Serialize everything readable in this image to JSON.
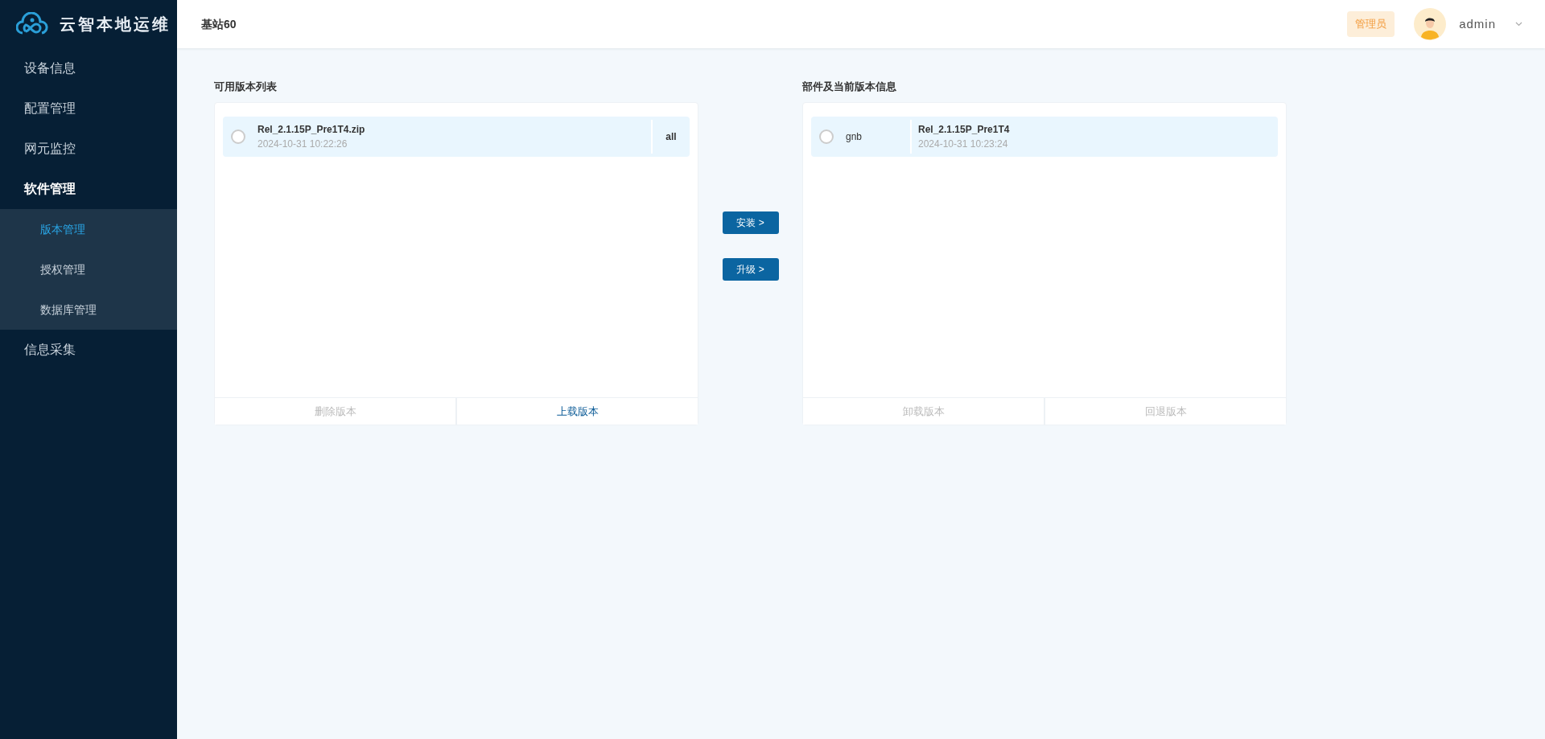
{
  "sidebar": {
    "brand": "云智本地运维",
    "items": [
      {
        "label": "设备信息",
        "expanded": false
      },
      {
        "label": "配置管理",
        "expanded": false
      },
      {
        "label": "网元监控",
        "expanded": false
      },
      {
        "label": "软件管理",
        "expanded": true,
        "children": [
          {
            "label": "版本管理",
            "selected": true
          },
          {
            "label": "授权管理",
            "selected": false
          },
          {
            "label": "数据库管理",
            "selected": false
          }
        ]
      },
      {
        "label": "信息采集",
        "expanded": false
      }
    ]
  },
  "header": {
    "title": "基站60",
    "role_badge": "管理员",
    "user": "admin"
  },
  "available_versions": {
    "title": "可用版本列表",
    "rows": [
      {
        "name": "Rel_2.1.15P_Pre1T4.zip",
        "time": "2024-10-31 10:22:26",
        "target": "all",
        "selected": false
      }
    ],
    "actions": [
      {
        "label": "删除版本",
        "disabled": true
      },
      {
        "label": "上载版本",
        "disabled": false
      }
    ]
  },
  "transfer_buttons": [
    {
      "label": "安装 >"
    },
    {
      "label": "升级 >"
    }
  ],
  "current_versions": {
    "title": "部件及当前版本信息",
    "rows": [
      {
        "component": "gnb",
        "version": "Rel_2.1.15P_Pre1T4",
        "time": "2024-10-31 10:23:24",
        "selected": false
      }
    ],
    "actions": [
      {
        "label": "卸载版本",
        "disabled": true
      },
      {
        "label": "回退版本",
        "disabled": true
      }
    ]
  }
}
